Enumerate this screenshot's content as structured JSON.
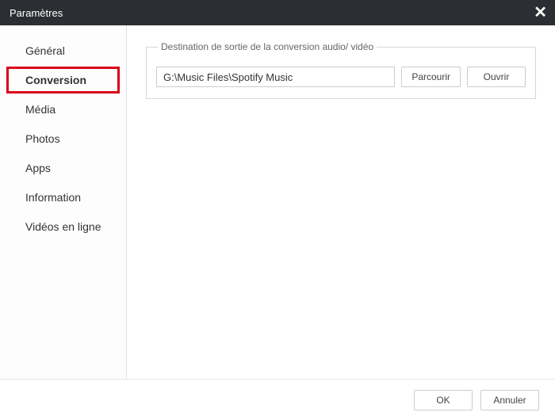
{
  "window": {
    "title": "Paramètres"
  },
  "sidebar": {
    "items": [
      {
        "label": "Général"
      },
      {
        "label": "Conversion"
      },
      {
        "label": "Média"
      },
      {
        "label": "Photos"
      },
      {
        "label": "Apps"
      },
      {
        "label": "Information"
      },
      {
        "label": "Vidéos en ligne"
      }
    ],
    "active_index": 1
  },
  "content": {
    "destination": {
      "legend": "Destination de sortie de la conversion audio/ vidéo",
      "path": "G:\\Music Files\\Spotify Music",
      "browse_label": "Parcourir",
      "open_label": "Ouvrir"
    }
  },
  "footer": {
    "ok_label": "OK",
    "cancel_label": "Annuler"
  }
}
